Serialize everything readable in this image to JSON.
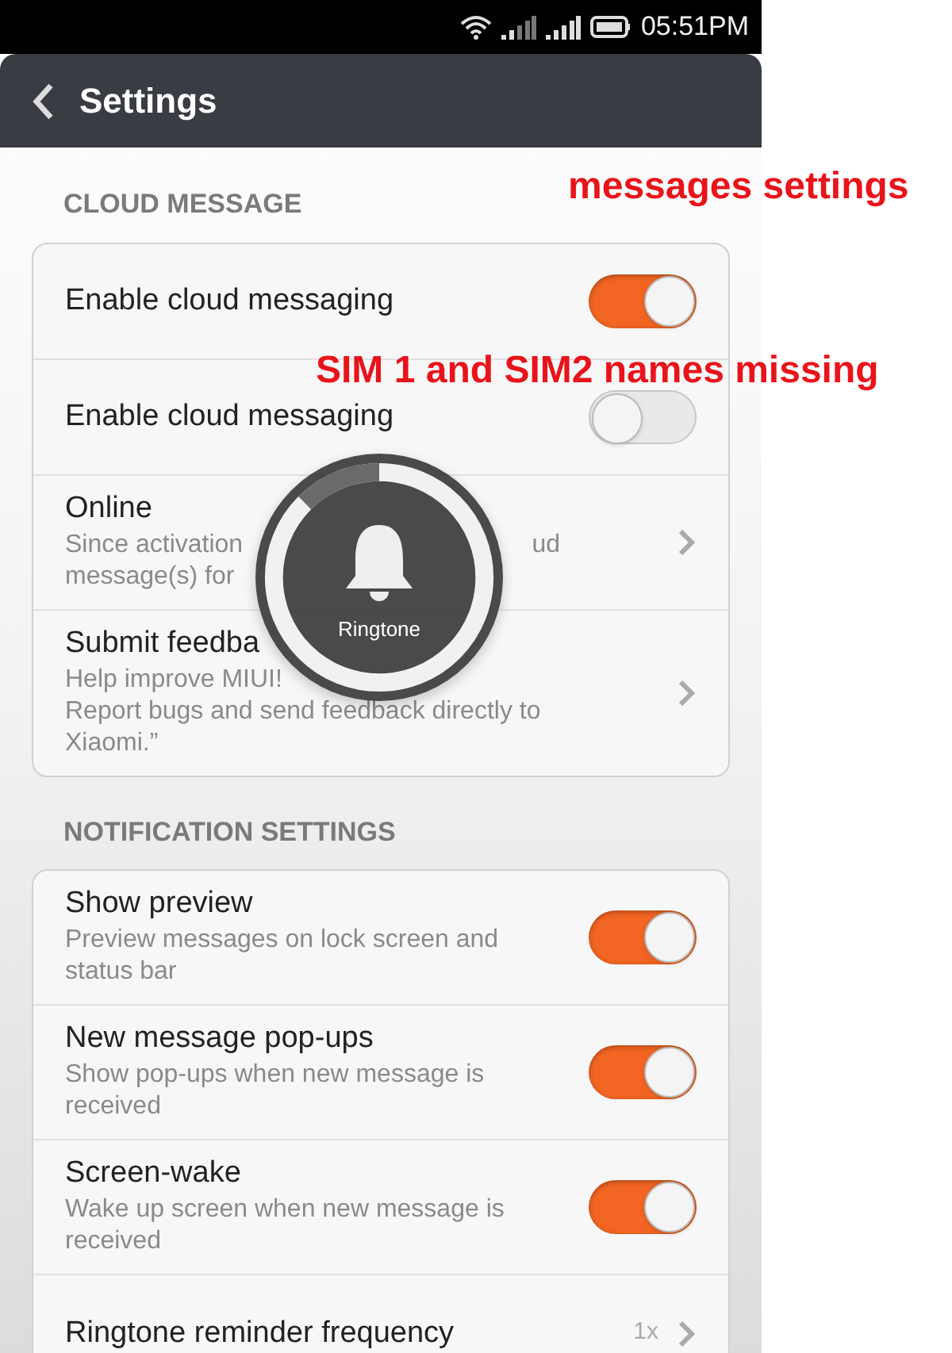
{
  "status_bar": {
    "time": "05:51PM"
  },
  "header": {
    "title": "Settings"
  },
  "sections": [
    {
      "title": "CLOUD MESSAGE",
      "items": [
        {
          "kind": "toggle",
          "title": "Enable cloud messaging",
          "on": true
        },
        {
          "kind": "toggle",
          "title": "Enable cloud messaging",
          "on": false
        },
        {
          "kind": "link",
          "title": "Online",
          "description_lines": [
            [
              "Since activation",
              "ud"
            ],
            [
              "message(s) for"
            ]
          ]
        },
        {
          "kind": "link",
          "title": "Submit feedba",
          "description": "Help improve MIUI!\nReport bugs and send feedback directly to\nXiaomi.”"
        }
      ]
    },
    {
      "title": "NOTIFICATION SETTINGS",
      "items": [
        {
          "kind": "toggle",
          "title": "Show preview",
          "description": "Preview messages on lock screen and status bar",
          "on": true
        },
        {
          "kind": "toggle",
          "title": "New message pop-ups",
          "description": "Show pop-ups when new message is received",
          "on": true
        },
        {
          "kind": "toggle",
          "title": "Screen-wake",
          "description": "Wake up screen when new message is received",
          "on": true
        },
        {
          "kind": "link",
          "title": "Ringtone reminder frequency",
          "value": "1x"
        }
      ]
    }
  ],
  "overlay": {
    "label": "Ringtone"
  },
  "annotations": [
    "messages settings",
    "SIM 1 and SIM2 names missing"
  ]
}
